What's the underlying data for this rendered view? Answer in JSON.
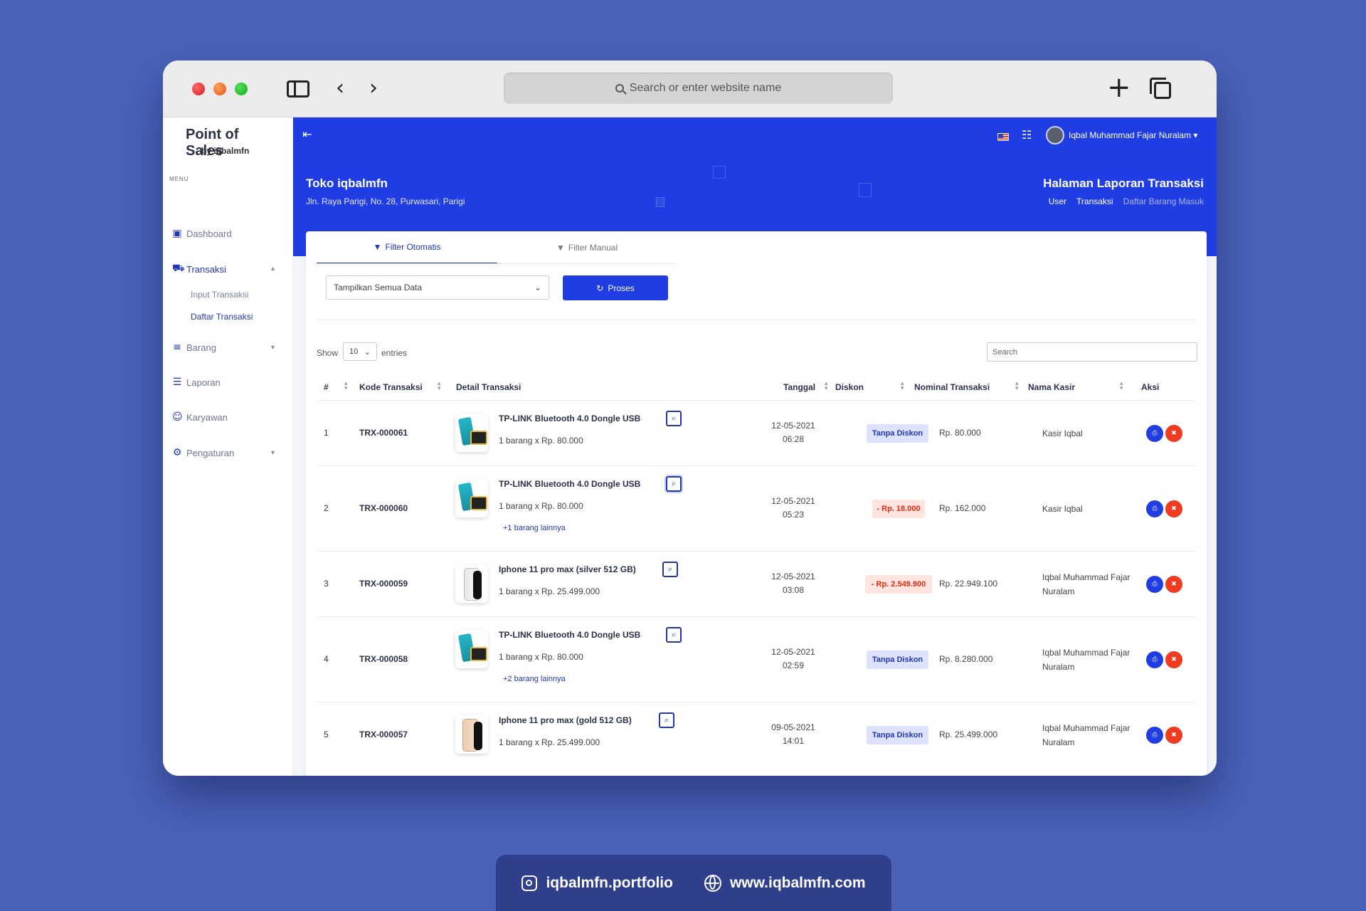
{
  "browser": {
    "address_placeholder": "Search or enter website name"
  },
  "sidebar": {
    "brand_title": "Point of Sales",
    "brand_subtitle": "by iqbalmfn",
    "menu_label": "MENU",
    "items": [
      {
        "label": "Dashboard",
        "icon": "monitor-icon"
      },
      {
        "label": "Transaksi",
        "icon": "cart-icon",
        "sub": [
          "Input Transaksi",
          "Daftar Transaksi"
        ]
      },
      {
        "label": "Barang",
        "icon": "database-icon"
      },
      {
        "label": "Laporan",
        "icon": "document-icon"
      },
      {
        "label": "Karyawan",
        "icon": "users-icon"
      },
      {
        "label": "Pengaturan",
        "icon": "gear-icon"
      }
    ]
  },
  "header": {
    "user_name": "Iqbal Muhammad Fajar Nuralam",
    "store_name": "Toko iqbalmfn",
    "store_address": "Jln. Raya Parigi, No. 28, Purwasari, Parigi",
    "page_title": "Halaman Laporan Transaksi",
    "breadcrumb": [
      "User",
      "Transaksi",
      "Daftar Barang Masuk"
    ]
  },
  "filter": {
    "tab_auto": "Filter Otomatis",
    "tab_manual": "Filter Manual",
    "select_value": "Tampilkan Semua Data",
    "proses_label": "Proses"
  },
  "table": {
    "show_label": "Show",
    "entries_value": "10",
    "entries_label": "entries",
    "search_placeholder": "Search",
    "headers": [
      "#",
      "Kode Transaksi",
      "Detail Transaksi",
      "Tanggal",
      "Diskon",
      "Nominal Transaksi",
      "Nama Kasir",
      "Aksi"
    ],
    "rows": [
      {
        "num": "1",
        "code": "TRX-000061",
        "product": "TP-LINK Bluetooth 4.0 Dongle USB",
        "qty": "1 barang x Rp. 80.000",
        "more": "",
        "date": "12-05-2021",
        "time": "06:28",
        "discount": "Tanpa Diskon",
        "nominal": "Rp. 80.000",
        "cashier": "Kasir Iqbal"
      },
      {
        "num": "2",
        "code": "TRX-000060",
        "product": "TP-LINK Bluetooth 4.0 Dongle USB",
        "qty": "1 barang x Rp. 80.000",
        "more": "+1 barang lainnya",
        "date": "12-05-2021",
        "time": "05:23",
        "discount": "- Rp. 18.000",
        "nominal": "Rp. 162.000",
        "cashier": "Kasir Iqbal"
      },
      {
        "num": "3",
        "code": "TRX-000059",
        "product": "Iphone 11 pro max (silver 512 GB)",
        "qty": "1 barang x Rp. 25.499.000",
        "more": "",
        "date": "12-05-2021",
        "time": "03:08",
        "discount": "- Rp. 2.549.900",
        "nominal": "Rp. 22.949.100",
        "cashier": "Iqbal Muhammad Fajar Nuralam"
      },
      {
        "num": "4",
        "code": "TRX-000058",
        "product": "TP-LINK Bluetooth 4.0 Dongle USB",
        "qty": "1 barang x Rp. 80.000",
        "more": "+2 barang lainnya",
        "date": "12-05-2021",
        "time": "02:59",
        "discount": "Tanpa Diskon",
        "nominal": "Rp. 8.280.000",
        "cashier": "Iqbal Muhammad Fajar Nuralam"
      },
      {
        "num": "5",
        "code": "TRX-000057",
        "product": "Iphone 11 pro max (gold 512 GB)",
        "qty": "1 barang x Rp. 25.499.000",
        "more": "",
        "date": "09-05-2021",
        "time": "14:01",
        "discount": "Tanpa Diskon",
        "nominal": "Rp. 25.499.000",
        "cashier": "Iqbal Muhammad Fajar Nuralam"
      }
    ]
  },
  "footer": {
    "instagram": "iqbalmfn.portfolio",
    "website": "www.iqbalmfn.com"
  },
  "colors": {
    "accent": "#1f3de3",
    "danger": "#ef3b1f",
    "background": "#4a63b8"
  }
}
